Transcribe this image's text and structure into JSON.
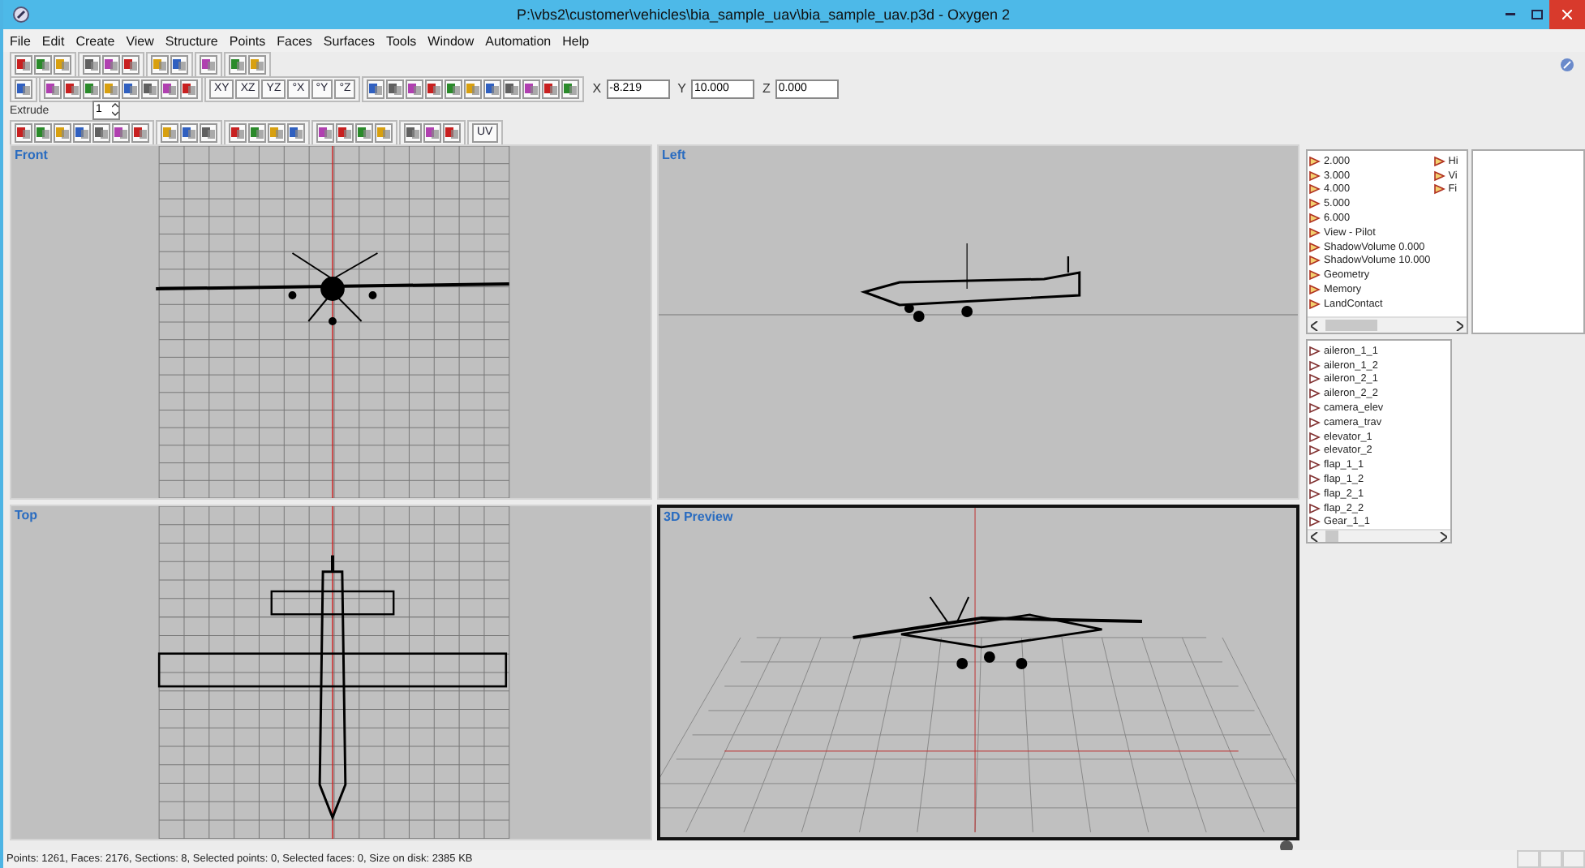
{
  "window": {
    "title": "P:\\vbs2\\customer\\vehicles\\bia_sample_uav\\bia_sample_uav.p3d - Oxygen 2"
  },
  "menu": [
    "File",
    "Edit",
    "Create",
    "View",
    "Structure",
    "Points",
    "Faces",
    "Surfaces",
    "Tools",
    "Window",
    "Automation",
    "Help"
  ],
  "toolbars": [
    {
      "items": [
        {
          "kind": "icon"
        },
        {
          "kind": "icon"
        },
        {
          "kind": "icon"
        },
        {
          "kind": "separator"
        },
        {
          "kind": "icon"
        },
        {
          "kind": "icon"
        },
        {
          "kind": "icon"
        },
        {
          "kind": "separator"
        },
        {
          "kind": "icon"
        },
        {
          "kind": "icon"
        },
        {
          "kind": "separator"
        },
        {
          "kind": "icon"
        },
        {
          "kind": "separator"
        },
        {
          "kind": "icon"
        },
        {
          "kind": "icon"
        }
      ]
    },
    {
      "items": [
        {
          "kind": "icon"
        },
        {
          "kind": "separator"
        },
        {
          "kind": "icon"
        },
        {
          "kind": "icon"
        },
        {
          "kind": "icon"
        },
        {
          "kind": "icon"
        },
        {
          "kind": "icon"
        },
        {
          "kind": "icon"
        },
        {
          "kind": "icon"
        },
        {
          "kind": "icon"
        },
        {
          "kind": "separator"
        },
        {
          "kind": "text",
          "label": "XY"
        },
        {
          "kind": "text",
          "label": "XZ"
        },
        {
          "kind": "text",
          "label": "YZ"
        },
        {
          "kind": "text",
          "label": "°X"
        },
        {
          "kind": "text",
          "label": "°Y"
        },
        {
          "kind": "text",
          "label": "°Z"
        },
        {
          "kind": "separator"
        },
        {
          "kind": "icon"
        },
        {
          "kind": "icon"
        },
        {
          "kind": "icon"
        },
        {
          "kind": "icon"
        },
        {
          "kind": "icon"
        },
        {
          "kind": "icon"
        },
        {
          "kind": "icon"
        },
        {
          "kind": "icon"
        },
        {
          "kind": "icon"
        },
        {
          "kind": "icon"
        },
        {
          "kind": "icon"
        }
      ]
    },
    {
      "items": [
        {
          "kind": "icon"
        },
        {
          "kind": "icon"
        },
        {
          "kind": "icon"
        },
        {
          "kind": "icon"
        },
        {
          "kind": "icon"
        },
        {
          "kind": "icon"
        },
        {
          "kind": "icon"
        },
        {
          "kind": "separator"
        },
        {
          "kind": "icon"
        },
        {
          "kind": "icon"
        },
        {
          "kind": "icon"
        },
        {
          "kind": "separator"
        },
        {
          "kind": "icon"
        },
        {
          "kind": "icon"
        },
        {
          "kind": "icon"
        },
        {
          "kind": "icon"
        },
        {
          "kind": "separator"
        },
        {
          "kind": "icon"
        },
        {
          "kind": "icon"
        },
        {
          "kind": "icon"
        },
        {
          "kind": "icon"
        },
        {
          "kind": "separator"
        },
        {
          "kind": "icon"
        },
        {
          "kind": "icon"
        },
        {
          "kind": "icon"
        },
        {
          "kind": "separator"
        },
        {
          "kind": "text",
          "label": "UV"
        }
      ]
    }
  ],
  "coords": [
    {
      "label": "X",
      "value": "-8.219"
    },
    {
      "label": "Y",
      "value": "10.000"
    },
    {
      "label": "Z",
      "value": "0.000"
    }
  ],
  "extrude": {
    "label": "Extrude",
    "value": "1"
  },
  "viewports": [
    {
      "title": "Front",
      "kind": "front",
      "active": false
    },
    {
      "title": "Left",
      "kind": "left",
      "active": false
    },
    {
      "title": "Top",
      "kind": "top",
      "active": false
    },
    {
      "title": "3D Preview",
      "kind": "perspective",
      "active": true
    }
  ],
  "lod_list": {
    "columns": [
      [
        "2.000",
        "3.000",
        "4.000",
        "5.000",
        "6.000",
        "View - Pilot",
        "ShadowVolume 0.000",
        "ShadowVolume 10.000",
        "Geometry",
        "Memory",
        "LandContact"
      ],
      [
        "Hi",
        "Vi",
        "Fi"
      ]
    ]
  },
  "selection_list": [
    "aileron_1_1",
    "aileron_1_2",
    "aileron_2_1",
    "aileron_2_2",
    "camera_elev",
    "camera_trav",
    "elevator_1",
    "elevator_2",
    "flap_1_1",
    "flap_1_2",
    "flap_2_1",
    "flap_2_2",
    "Gear_1_1"
  ],
  "status_bar": "Points: 1261, Faces: 2176, Sections: 8, Selected points: 0, Selected faces: 0, Size on disk: 2385 KB"
}
